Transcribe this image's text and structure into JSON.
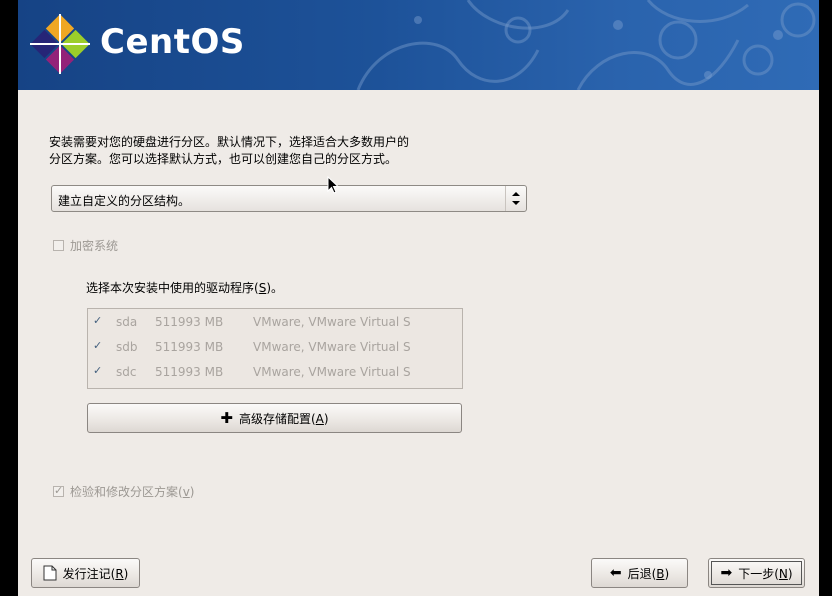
{
  "brand": "CentOS",
  "intro": {
    "line1": "安装需要对您的硬盘进行分区。默认情况下，选择适合大多数用户的",
    "line2": "分区方案。您可以选择默认方式，也可以创建您自己的分区方式。"
  },
  "partition_select": {
    "value": "建立自定义的分区结构。"
  },
  "encrypt": {
    "label": "加密系统",
    "checked": false
  },
  "drives": {
    "label": "选择本次安装中使用的驱动程序(",
    "label_key": "S",
    "label_tail": ")。",
    "rows": [
      {
        "name": "sda",
        "size": "511993 MB",
        "model": "VMware, VMware Virtual S",
        "checked": true
      },
      {
        "name": "sdb",
        "size": "511993 MB",
        "model": "VMware, VMware Virtual S",
        "checked": true
      },
      {
        "name": "sdc",
        "size": "511993 MB",
        "model": "VMware, VMware Virtual S",
        "checked": true
      }
    ]
  },
  "advanced_storage": {
    "label": "高级存储配置(",
    "key": "A",
    "tail": ")"
  },
  "review": {
    "label": "检验和修改分区方案(",
    "key": "v",
    "tail": ")",
    "checked": true
  },
  "buttons": {
    "release_notes": {
      "label": "发行注记(",
      "key": "R",
      "tail": ")"
    },
    "back": {
      "label": "后退(",
      "key": "B",
      "tail": ")"
    },
    "next": {
      "label": "下一步(",
      "key": "N",
      "tail": ")"
    }
  },
  "colors": {
    "banner": "#1d5299",
    "background": "#efebe7",
    "disabled_text": "#9c9893"
  }
}
